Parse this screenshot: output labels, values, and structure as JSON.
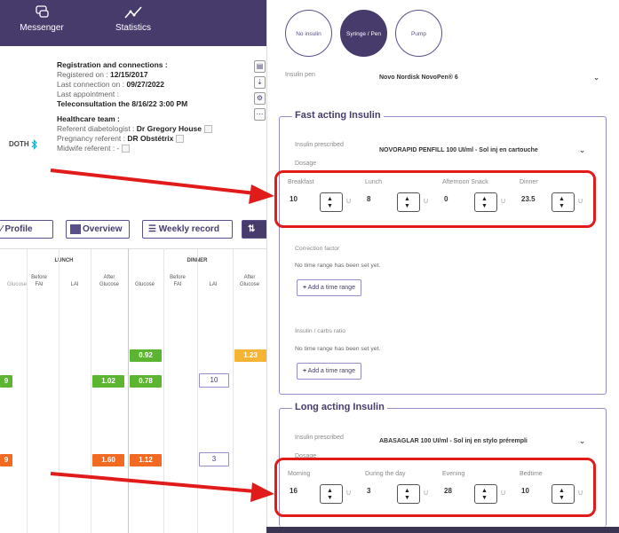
{
  "topnav": {
    "items": [
      {
        "label": "Messenger",
        "icon": "chat-bubbles-icon"
      },
      {
        "label": "Statistics",
        "icon": "line-chart-icon"
      }
    ]
  },
  "patient": {
    "reg_title": "Registration and connections :",
    "registered_label": "Registered on :",
    "registered_value": "12/15/2017",
    "last_conn_label": "Last connection on :",
    "last_conn_value": "09/27/2022",
    "last_appt_label": "Last appointment :",
    "last_appt_value": "Teleconsultation the 8/16/22 3:00 PM",
    "team_title": "Healthcare team :",
    "diabetologist_label": "Referent diabetologist :",
    "diabetologist_value": "Dr Gregory House",
    "pregnancy_label": "Pregnancy referent :",
    "pregnancy_value": "DR Obstétrix",
    "midwife_label": "Midwife referent :",
    "midwife_value": "-",
    "device_partial": "DOTH"
  },
  "tabs": {
    "profile": "Profile",
    "overview": "Overview",
    "weekly": "Weekly record"
  },
  "grid": {
    "lunch": "LUNCH",
    "dinner": "DINNER",
    "before": "Before",
    "after": "After",
    "fai": "FAI",
    "lai": "LAI",
    "glucose": "Glucose",
    "cells": [
      {
        "text": "0.92"
      },
      {
        "text": "1.23"
      },
      {
        "text": "9"
      },
      {
        "text": "1.02"
      },
      {
        "text": "0.78"
      },
      {
        "text": "10"
      },
      {
        "text": "9"
      },
      {
        "text": "1.60"
      },
      {
        "text": "1.12"
      },
      {
        "text": "3"
      }
    ]
  },
  "insulin_modes": {
    "none": "No insulin",
    "syringe": "Syringe / Pen",
    "pump": "Pump"
  },
  "pen": {
    "label": "Insulin pen",
    "value": "Novo Nordisk NovoPen® 6"
  },
  "fast": {
    "legend": "Fast acting Insulin",
    "prescribed_label": "Insulin prescribed",
    "prescribed_value": "NOVORAPID PENFILL 100 UI/ml - Sol inj en cartouche",
    "dosage_label": "Dosage",
    "doses": [
      {
        "label": "Breakfast",
        "value": "10",
        "unit": "U"
      },
      {
        "label": "Lunch",
        "value": "8",
        "unit": "U"
      },
      {
        "label": "Afternoon Snack",
        "value": "0",
        "unit": "U"
      },
      {
        "label": "Dinner",
        "value": "23.5",
        "unit": "U"
      }
    ],
    "correction_label": "Correction factor",
    "correction_empty": "No time range has been set yet.",
    "ratio_label": "Insulin / carbs ratio",
    "ratio_empty": "No time range has been set yet.",
    "add_range": "Add a time range"
  },
  "long": {
    "legend": "Long acting Insulin",
    "prescribed_label": "Insulin prescribed",
    "prescribed_value": "ABASAGLAR 100 UI/ml - Sol inj en stylo prérempli",
    "dosage_label": "Dosage",
    "doses": [
      {
        "label": "Morning",
        "value": "16",
        "unit": "U"
      },
      {
        "label": "During the day",
        "value": "3",
        "unit": "U"
      },
      {
        "label": "Evening",
        "value": "28",
        "unit": "U"
      },
      {
        "label": "Bedtime",
        "value": "10",
        "unit": "U"
      }
    ]
  },
  "colors": {
    "purple": "#463b6a",
    "red": "#e11a1a",
    "green": "#5cb531",
    "orange": "#f26a21",
    "yellow": "#f5b433"
  }
}
